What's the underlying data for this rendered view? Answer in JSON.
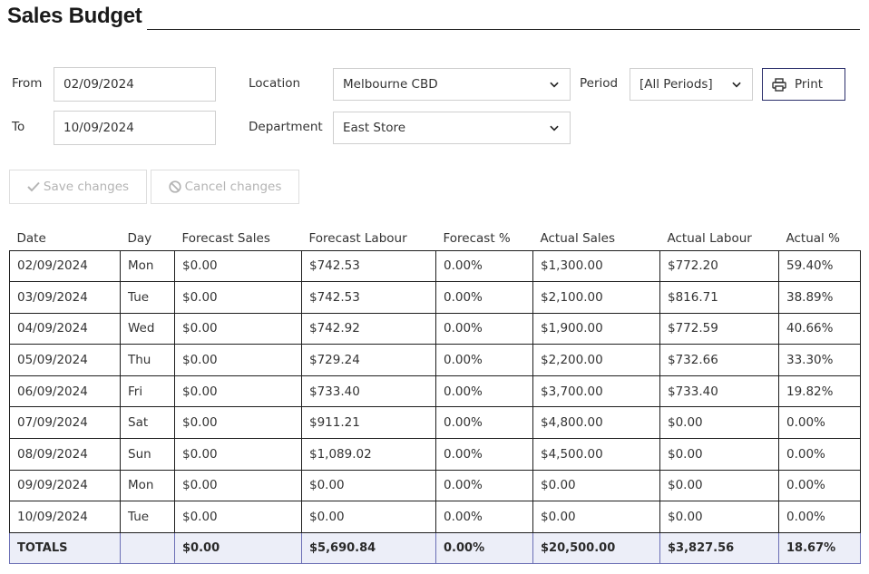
{
  "page": {
    "title": "Sales Budget"
  },
  "filters": {
    "from_label": "From",
    "from_value": "02/09/2024",
    "to_label": "To",
    "to_value": "10/09/2024",
    "location_label": "Location",
    "location_value": "Melbourne CBD",
    "department_label": "Department",
    "department_value": "East Store",
    "period_label": "Period",
    "period_value": "[All Periods]",
    "print_label": "Print"
  },
  "actions": {
    "save_label": "Save changes",
    "cancel_label": "Cancel changes"
  },
  "table": {
    "headers": [
      "Date",
      "Day",
      "Forecast Sales",
      "Forecast Labour",
      "Forecast %",
      "Actual Sales",
      "Actual Labour",
      "Actual %"
    ],
    "rows": [
      [
        "02/09/2024",
        "Mon",
        "$0.00",
        "$742.53",
        "0.00%",
        "$1,300.00",
        "$772.20",
        "59.40%"
      ],
      [
        "03/09/2024",
        "Tue",
        "$0.00",
        "$742.53",
        "0.00%",
        "$2,100.00",
        "$816.71",
        "38.89%"
      ],
      [
        "04/09/2024",
        "Wed",
        "$0.00",
        "$742.92",
        "0.00%",
        "$1,900.00",
        "$772.59",
        "40.66%"
      ],
      [
        "05/09/2024",
        "Thu",
        "$0.00",
        "$729.24",
        "0.00%",
        "$2,200.00",
        "$732.66",
        "33.30%"
      ],
      [
        "06/09/2024",
        "Fri",
        "$0.00",
        "$733.40",
        "0.00%",
        "$3,700.00",
        "$733.40",
        "19.82%"
      ],
      [
        "07/09/2024",
        "Sat",
        "$0.00",
        "$911.21",
        "0.00%",
        "$4,800.00",
        "$0.00",
        "0.00%"
      ],
      [
        "08/09/2024",
        "Sun",
        "$0.00",
        "$1,089.02",
        "0.00%",
        "$4,500.00",
        "$0.00",
        "0.00%"
      ],
      [
        "09/09/2024",
        "Mon",
        "$0.00",
        "$0.00",
        "0.00%",
        "$0.00",
        "$0.00",
        "0.00%"
      ],
      [
        "10/09/2024",
        "Tue",
        "$0.00",
        "$0.00",
        "0.00%",
        "$0.00",
        "$0.00",
        "0.00%"
      ]
    ],
    "totals": [
      "TOTALS",
      "",
      "$0.00",
      "$5,690.84",
      "0.00%",
      "$20,500.00",
      "$3,827.56",
      "18.67%"
    ]
  },
  "icons": {
    "save": "check-icon",
    "cancel": "ban-icon",
    "print": "printer-icon",
    "dropdown": "chevron-down-icon"
  },
  "colors": {
    "print_border": "#2b2f6b",
    "totals_bg": "#eceef8",
    "totals_border": "#6b6fb5",
    "disabled_text": "#b4b4b4"
  }
}
